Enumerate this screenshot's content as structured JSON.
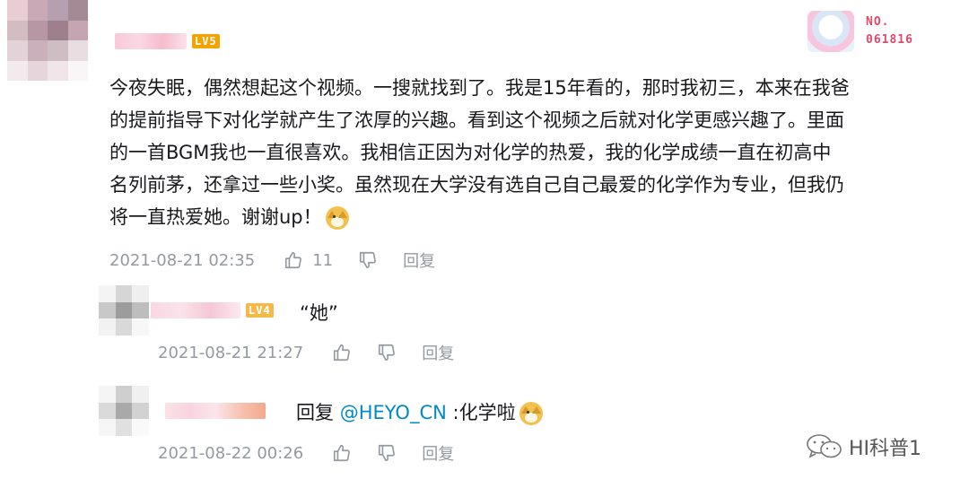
{
  "main_comment": {
    "level_badge": "LV5",
    "lines": [
      "今夜失眠，偶然想起这个视频。一搜就找到了。我是15年看的，那时我初三，本来在我爸",
      "的提前指导下对化学就产生了浓厚的兴趣。看到这个视频之后就对化学更感兴趣了。里面",
      "的一首BGM我也一直很喜欢。我相信正因为对化学的热爱，我的化学成绩一直在初高中",
      "名列前茅，还拿过一些小奖。虽然现在大学没有选自己自己最爱的化学作为专业，但我仍",
      "将一直热爱她。谢谢up！"
    ],
    "emoji": "doge",
    "time": "2021-08-21 02:35",
    "like_count": "11",
    "reply_label": "回复"
  },
  "fan_badge": {
    "label": "NO.",
    "number": "061816"
  },
  "replies": [
    {
      "level_badge": "LV4",
      "text": "“她”",
      "time": "2021-08-21 21:27",
      "reply_label": "回复"
    },
    {
      "prefix": "回复",
      "mention": "@HEYO_CN",
      "text": ":化学啦",
      "emoji": "doge",
      "time": "2021-08-22 00:26",
      "reply_label": "回复"
    }
  ],
  "watermark": {
    "text": "HI科普1",
    "icon": "wechat-icon"
  },
  "colors": {
    "link": "#008ac5",
    "meta": "#9499a0",
    "lv_badge": "#f5a300",
    "fan_badge": "#e04a6a"
  }
}
